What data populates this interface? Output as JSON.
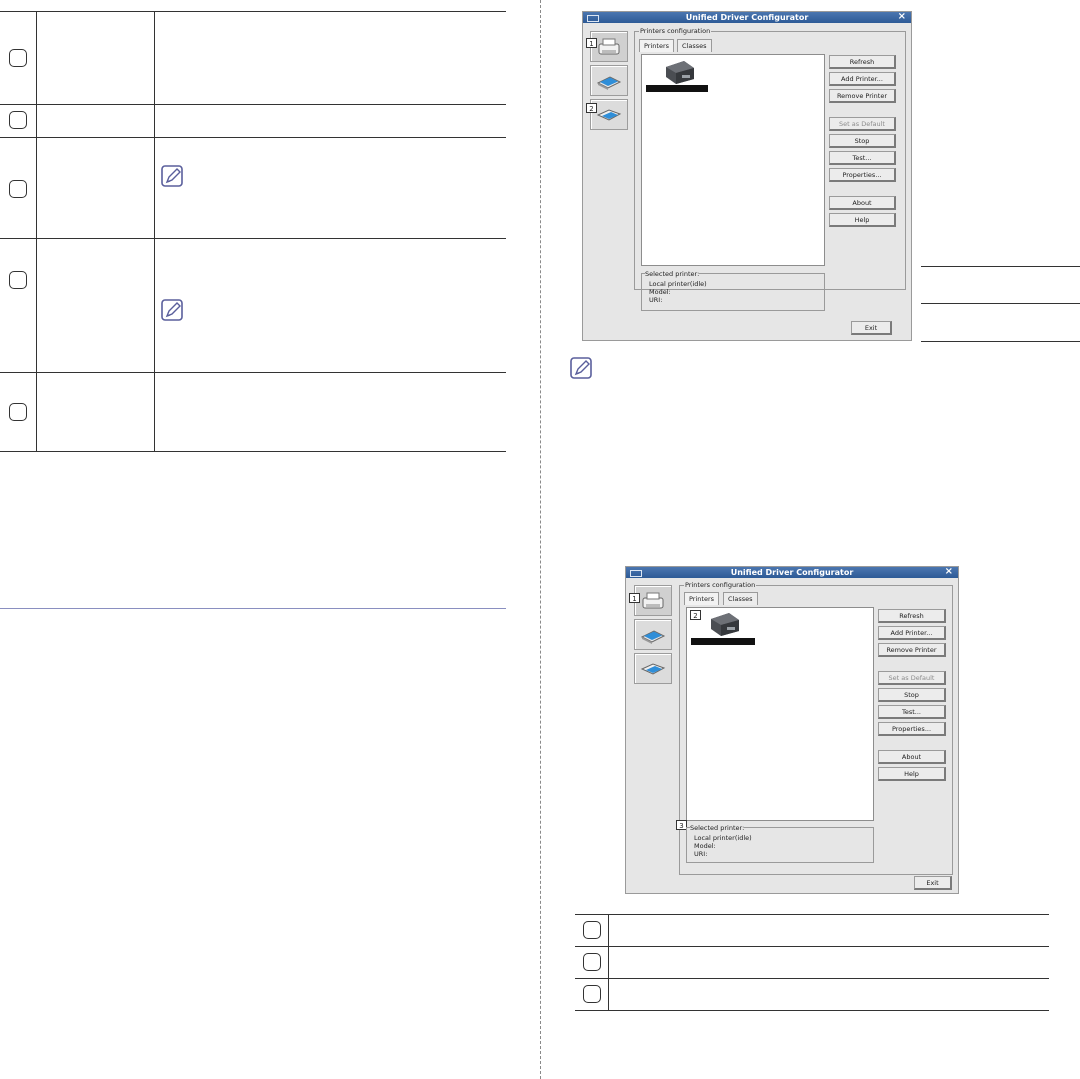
{
  "window1": {
    "title": "Unified Driver Configurator",
    "close": "×",
    "group_label": "Printers configuration",
    "tabs": [
      "Printers",
      "Classes"
    ],
    "buttons": [
      "Refresh",
      "Add Printer...",
      "Remove Printer",
      "Set as Default",
      "Stop",
      "Test...",
      "Properties...",
      "About",
      "Help"
    ],
    "selected_label": "Selected printer:",
    "selected_lines": [
      "Local printer(idle)",
      "Model:",
      "URI:"
    ],
    "exit": "Exit",
    "badges": [
      "1",
      "2"
    ]
  },
  "window2": {
    "title": "Unified Driver Configurator",
    "close": "×",
    "group_label": "Printers configuration",
    "tabs": [
      "Printers",
      "Classes"
    ],
    "buttons": [
      "Refresh",
      "Add Printer...",
      "Remove Printer",
      "Set as Default",
      "Stop",
      "Test...",
      "Properties...",
      "About",
      "Help"
    ],
    "selected_label": "Selected printer:",
    "selected_lines": [
      "Local printer(idle)",
      "Model:",
      "URI:"
    ],
    "exit": "Exit",
    "badges": [
      "1",
      "2",
      "3"
    ]
  },
  "icons": {
    "note": "note-pencil-icon",
    "printer": "printer-icon",
    "scanner": "scanner-icon",
    "port": "port-icon"
  },
  "colors": {
    "titlebar": "#2d5a96",
    "window_bg": "#e6e6e6",
    "divider_blue": "#8a8fc0"
  }
}
